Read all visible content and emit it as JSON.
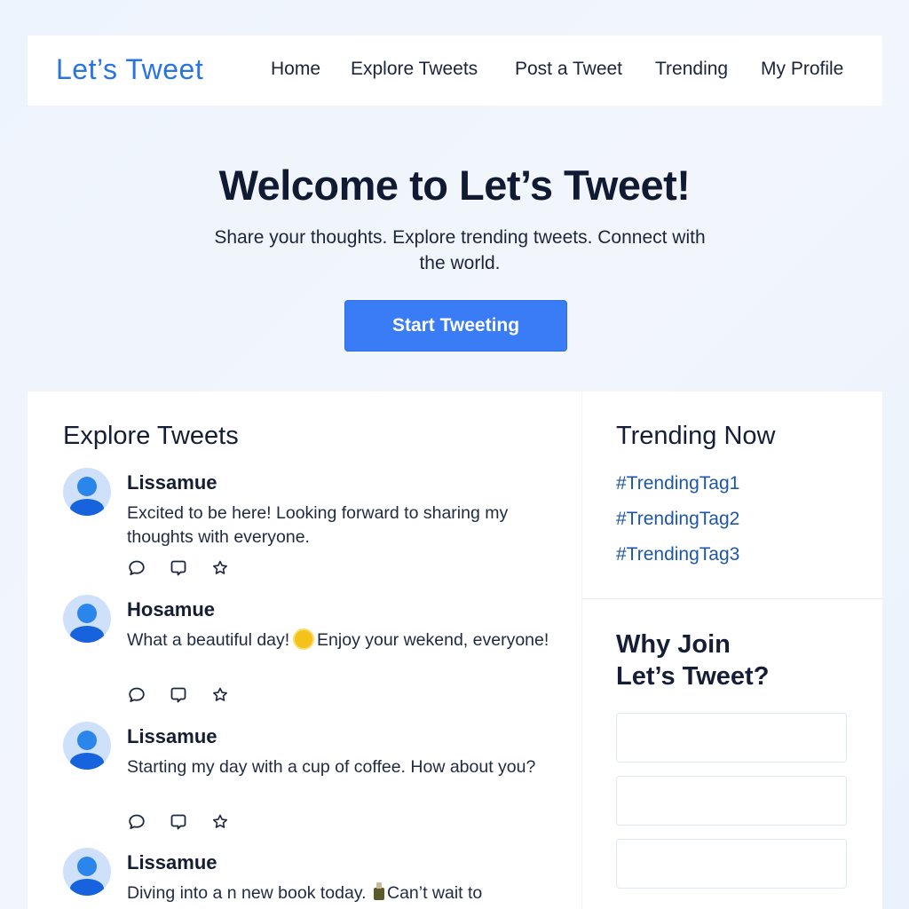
{
  "colors": {
    "accent": "#2874e2",
    "button": "#3a7cf5",
    "tag": "#1e56a8"
  },
  "nav": {
    "brand": "Let’s Tweet",
    "links": [
      "Home",
      "Explore Tweets",
      "Post a Tweet",
      "Trending",
      "My Profile"
    ]
  },
  "hero": {
    "title": "Welcome to Let’s Tweet!",
    "subtitle": "Share your thoughts. Explore trending tweets. Connect with the world.",
    "cta": "Start Tweeting"
  },
  "explore": {
    "title": "Explore Tweets",
    "tweets": [
      {
        "user": "Lissamue",
        "text": "Excited to be here! Looking forward to sharing my thoughts with everyone."
      },
      {
        "user": "Hosamue",
        "text_before": "What a beautiful day! ",
        "emoji": "sun-emoji",
        "text_after": " Enjoy your wekend, everyone!"
      },
      {
        "user": "Lissamue",
        "text": "Starting  my day with a cup of coffee. How about you?"
      },
      {
        "user": "Lissamue",
        "text_before": "Diving into a n new book today. ",
        "emoji": "book-emoji",
        "text_after": "Can’t wait to"
      }
    ],
    "action_icons": [
      "comment-icon",
      "reply-icon",
      "star-icon"
    ]
  },
  "trending": {
    "title": "Trending Now",
    "tags": [
      "#TrendingTag1",
      "#TrendingTag2",
      "#TrendingTag3"
    ]
  },
  "why": {
    "title_line1": "Why Join",
    "title_line2": "Let’s Tweet?"
  }
}
